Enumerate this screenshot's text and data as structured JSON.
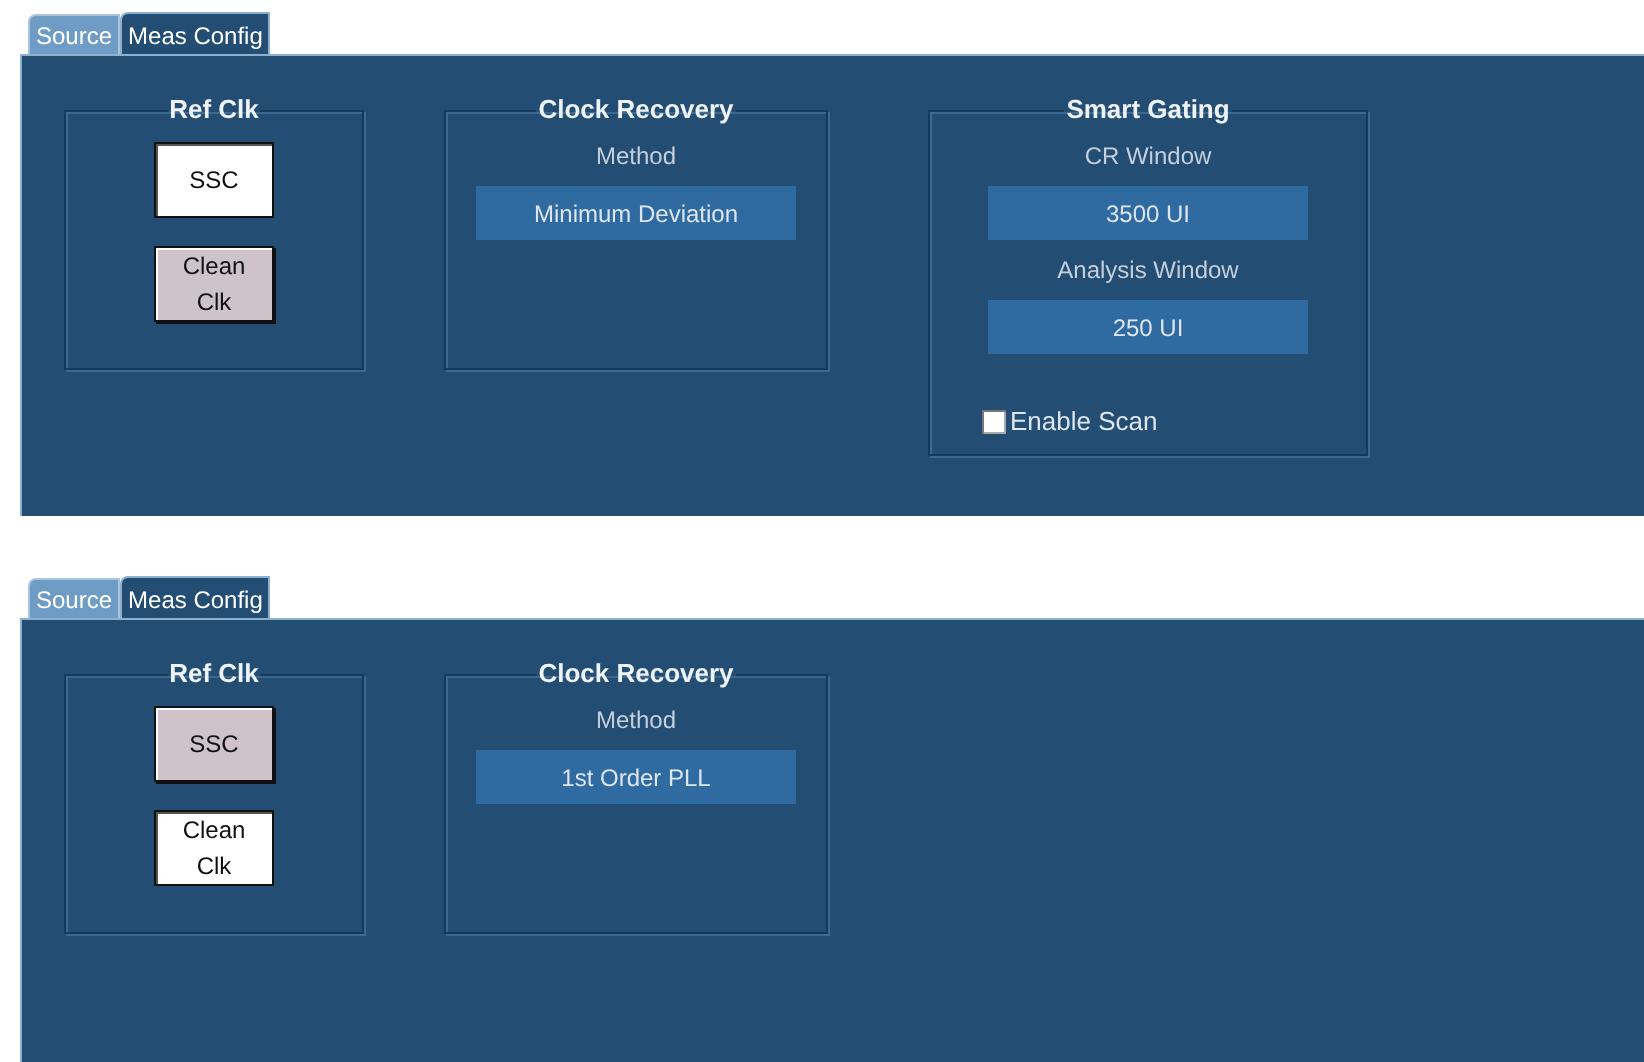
{
  "panels": [
    {
      "tabs": [
        {
          "label": "Source",
          "selected": false
        },
        {
          "label": "Meas Config",
          "selected": true
        }
      ],
      "groups": [
        {
          "kind": "ref_clk",
          "title": "Ref Clk",
          "items": [
            {
              "kind": "button",
              "label": "SSC",
              "selected": true
            },
            {
              "kind": "button",
              "label": "Clean Clk",
              "selected": false
            }
          ]
        },
        {
          "kind": "clock_recovery",
          "title": "Clock Recovery",
          "items": [
            {
              "kind": "label",
              "text": "Method"
            },
            {
              "kind": "value",
              "text": "Minimum Deviation"
            }
          ]
        },
        {
          "kind": "smart_gating",
          "title": "Smart Gating",
          "items": [
            {
              "kind": "label",
              "text": "CR Window"
            },
            {
              "kind": "value",
              "text": "3500 UI"
            },
            {
              "kind": "label",
              "text": "Analysis Window"
            },
            {
              "kind": "value",
              "text": "250 UI"
            },
            {
              "kind": "checkbox",
              "label": "Enable Scan",
              "checked": false
            }
          ]
        }
      ]
    },
    {
      "tabs": [
        {
          "label": "Source",
          "selected": false
        },
        {
          "label": "Meas Config",
          "selected": true
        }
      ],
      "groups": [
        {
          "kind": "ref_clk",
          "title": "Ref Clk",
          "items": [
            {
              "kind": "button",
              "label": "SSC",
              "selected": false
            },
            {
              "kind": "button",
              "label": "Clean Clk",
              "selected": true
            }
          ]
        },
        {
          "kind": "clock_recovery",
          "title": "Clock Recovery",
          "items": [
            {
              "kind": "label",
              "text": "Method"
            },
            {
              "kind": "value",
              "text": "1st Order PLL"
            }
          ]
        }
      ]
    }
  ]
}
